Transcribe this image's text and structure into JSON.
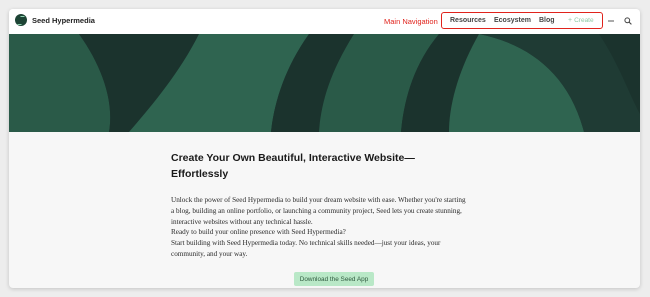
{
  "app": {
    "brand_name": "Seed Hypermedia"
  },
  "annotation": {
    "label": "Main Navigation",
    "color": "#e0231c"
  },
  "nav": {
    "items": [
      {
        "label": "Resources"
      },
      {
        "label": "Ecosystem"
      },
      {
        "label": "Blog"
      }
    ],
    "create_label": "Create",
    "icons": [
      "plus-icon",
      "minus-icon",
      "search-icon"
    ]
  },
  "hero": {
    "colors": {
      "base": "#1f3b34",
      "band_dark": "#1b332d",
      "band_mid": "#2a5a48",
      "band_light": "#2f6450"
    }
  },
  "article": {
    "headline": "Create Your Own Beautiful, Interactive Website—Effortlessly",
    "paragraphs": [
      "Unlock the power of Seed Hypermedia to build your dream website with ease. Whether you're starting a blog, building an online portfolio, or launching a community project, Seed lets you create stunning, interactive websites without any technical hassle.",
      "Ready to build your online presence with Seed Hypermedia?",
      "Start building with Seed Hypermedia today. No technical skills needed—just your ideas, your community, and your way."
    ],
    "cta_label": "Download the Seed App"
  },
  "colors": {
    "accent_green": "#b9e8c7",
    "brand_dark": "#1d4435"
  }
}
